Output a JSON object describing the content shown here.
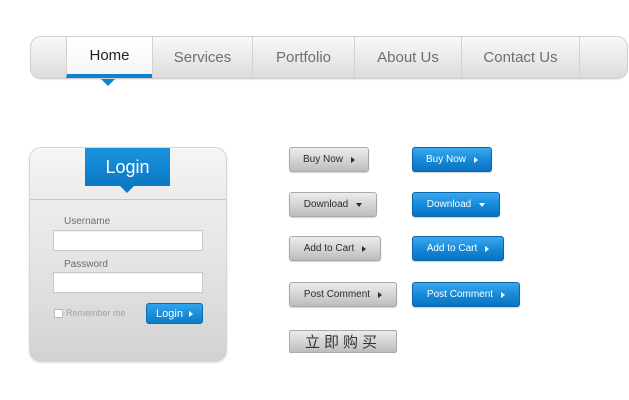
{
  "nav": {
    "items": [
      {
        "label": "Home",
        "active": true
      },
      {
        "label": "Services",
        "active": false
      },
      {
        "label": "Portfolio",
        "active": false
      },
      {
        "label": "About Us",
        "active": false
      },
      {
        "label": "Contact Us",
        "active": false
      }
    ]
  },
  "login": {
    "title": "Login",
    "username_label": "Username",
    "username_value": "",
    "password_label": "Password",
    "password_value": "",
    "remember_label": "Remember me",
    "submit_label": "Login"
  },
  "buttons": {
    "gray": {
      "buy_now": "Buy Now",
      "download": "Download",
      "add_to_cart": "Add to Cart",
      "post_comment": "Post Comment"
    },
    "blue": {
      "buy_now": "Buy Now",
      "download": "Download",
      "add_to_cart": "Add to Cart",
      "post_comment": "Post Comment"
    },
    "chinese_buy_now": "立即购买"
  },
  "colors": {
    "accent": "#0d83d0",
    "gray_button": "#d3d3d3",
    "blue_button": "#1488d7"
  },
  "icons": {
    "arrow_right": "triangle-right-icon",
    "dropdown": "triangle-down-icon"
  }
}
